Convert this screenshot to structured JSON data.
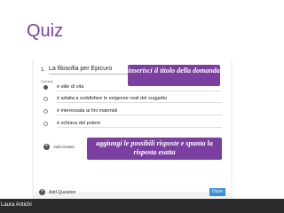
{
  "slide": {
    "title": "Quiz",
    "author": "Laura Antichi"
  },
  "question": {
    "number": "1.",
    "title": "La filosofia per Epicuro",
    "correct_label": "Correct",
    "answers": [
      {
        "text": "è stile di vita",
        "correct": true
      },
      {
        "text": "è adatta a soddisfare le esigenze reali del soggetto",
        "correct": false
      },
      {
        "text": "è interessata ai fini materiali",
        "correct": false
      },
      {
        "text": "è schiava del potere",
        "correct": false
      }
    ],
    "add_answer_label": "Add Answer"
  },
  "footer": {
    "add_question_label": "Add Question",
    "done_label": "Done"
  },
  "callouts": {
    "title_hint": "inserisci il titolo della domanda",
    "answers_hint": "aggiungi le possibili risposte e spunta la risposta esatta"
  },
  "colors": {
    "accent": "#7b3fa0",
    "done": "#3a8fd8"
  },
  "icons": {
    "add": "plus-circle-icon",
    "radio": "radio-icon"
  }
}
